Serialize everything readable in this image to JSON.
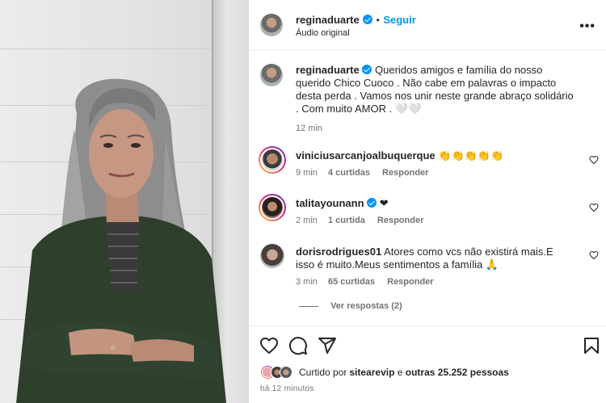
{
  "post": {
    "author": "reginaduarte",
    "follow_label": "Seguir",
    "separator": "•",
    "audio_label": "Áudio original",
    "more_label": "•••"
  },
  "caption": {
    "author": "reginaduarte",
    "text": "Queridos amigos e família do nosso querido Chico Cuoco . Não cabe em palavras o impacto desta perda . Vamos nos unir neste grande abraço solidário . Com muito AMOR . 🤍🤍",
    "time": "12 min"
  },
  "comments": [
    {
      "author": "viniciusarcanjoalbuquerque",
      "text": "👏👏👏👏👏",
      "time": "9 min",
      "likes": "4 curtidas",
      "reply": "Responder",
      "verified": false
    },
    {
      "author": "talitayounann",
      "text": "❤",
      "time": "2 min",
      "likes": "1 curtida",
      "reply": "Responder",
      "verified": true
    },
    {
      "author": "dorisrodrigues01",
      "text": "Atores como vcs não existirá mais.E isso é muito.Meus sentimentos a família 🙏",
      "time": "3 min",
      "likes": "65 curtidas",
      "reply": "Responder",
      "verified": false
    }
  ],
  "view_replies": "Ver respostas (2)",
  "likes_line": {
    "prefix": "Curtido por ",
    "user": "sitearevip",
    "middle": " e ",
    "others": "outras 25.252 pessoas"
  },
  "time_ago": "há 12 minutos",
  "icons": [
    "heart-icon",
    "comment-icon",
    "share-icon",
    "bookmark-icon",
    "verified-badge-icon",
    "more-options-icon"
  ],
  "colors": {
    "link": "#0095f6",
    "text": "#262626",
    "muted": "#737373",
    "verified": "#0095f6"
  }
}
